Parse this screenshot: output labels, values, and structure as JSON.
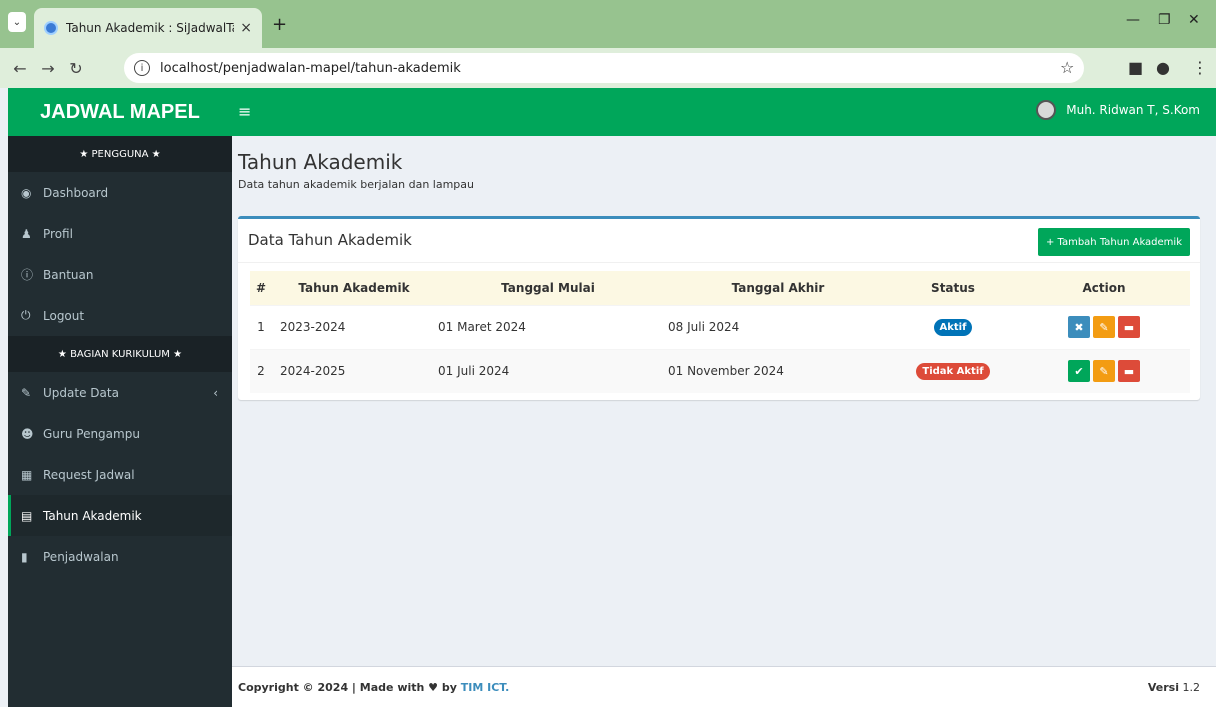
{
  "browser": {
    "tab_title": "Tahun Akademik : SiJadwalTa",
    "url": "localhost/penjadwalan-mapel/tahun-akademik"
  },
  "app": {
    "brand": "JADWAL MAPEL",
    "user_name": "Muh. Ridwan T, S.Kom"
  },
  "sidebar": {
    "section_user": "★ PENGGUNA ★",
    "section_curriculum": "★ BAGIAN KURIKULUM ★",
    "items_user": [
      {
        "label": "Dashboard",
        "icon": "dashboard-icon"
      },
      {
        "label": "Profil",
        "icon": "user-icon"
      },
      {
        "label": "Bantuan",
        "icon": "info-icon"
      },
      {
        "label": "Logout",
        "icon": "power-icon"
      }
    ],
    "items_curriculum": [
      {
        "label": "Update Data",
        "icon": "edit-icon"
      },
      {
        "label": "Guru Pengampu",
        "icon": "users-icon"
      },
      {
        "label": "Request Jadwal",
        "icon": "table-icon"
      },
      {
        "label": "Tahun Akademik",
        "icon": "calendar-icon",
        "active": true
      },
      {
        "label": "Penjadwalan",
        "icon": "file-icon"
      }
    ]
  },
  "page": {
    "title": "Tahun Akademik",
    "subtitle": "Data tahun akademik berjalan dan lampau"
  },
  "box": {
    "title": "Data Tahun Akademik",
    "add_button": "+ Tambah Tahun Akademik"
  },
  "table": {
    "headers": [
      "#",
      "Tahun Akademik",
      "Tanggal Mulai",
      "Tanggal Akhir",
      "Status",
      "Action"
    ],
    "rows": [
      {
        "no": "1",
        "tahun": "2023-2024",
        "mulai": "01 Maret 2024",
        "akhir": "08 Juli 2024",
        "status": "Aktif"
      },
      {
        "no": "2",
        "tahun": "2024-2025",
        "mulai": "01 Juli 2024",
        "akhir": "01 November 2024",
        "status": "Tidak Aktif"
      }
    ]
  },
  "footer": {
    "copyright": "Copyright © 2024 | Made with ♥ by ",
    "team": "TIM ICT.",
    "version_label": "Versi",
    "version": "1.2"
  },
  "colors": {
    "primary_green": "#00a65a",
    "sidebar_dark": "#222d32",
    "accent_blue": "#3c8dbc",
    "danger_red": "#dd4b39",
    "warning_orange": "#f39c12"
  }
}
